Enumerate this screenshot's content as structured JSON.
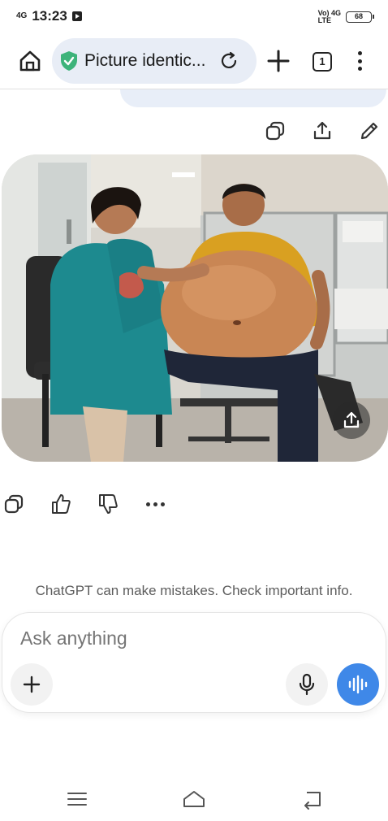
{
  "status_bar": {
    "time": "13:23",
    "signal_left": "4G",
    "network_right_top": "Vo) 4G",
    "network_right_bottom": "LTE",
    "battery": "68"
  },
  "browser": {
    "url_title": "Picture identic...",
    "tab_count": "1"
  },
  "chat": {
    "disclaimer": "ChatGPT can make mistakes. Check important info.",
    "composer_placeholder": "Ask anything"
  },
  "colors": {
    "accent": "#3f88e8",
    "url_pill": "#e8edf6",
    "bubble": "#e8eef8",
    "shield_green": "#3db37a"
  },
  "icons": {
    "image_actions": [
      "copy-icon",
      "share-icon",
      "edit-icon"
    ],
    "message_actions": [
      "copy-icon",
      "thumbs-up-icon",
      "thumbs-down-icon",
      "more-icon"
    ]
  }
}
